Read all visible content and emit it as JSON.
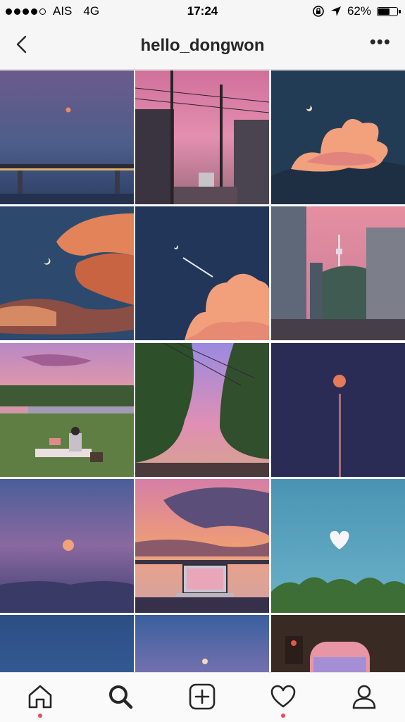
{
  "status": {
    "carrier": "AIS",
    "network": "4G",
    "time": "17:24",
    "battery": "62%",
    "battery_level": 0.62
  },
  "header": {
    "title": "hello_dongwon"
  },
  "grid": {
    "tiles": [
      {
        "alt": "moon-over-bridge-dusk"
      },
      {
        "alt": "street-with-power-lines-pink-sky"
      },
      {
        "alt": "glowing-cloud-night-sky"
      },
      {
        "alt": "crescent-moon-sunset-clouds"
      },
      {
        "alt": "airplane-trail-moon-cloud"
      },
      {
        "alt": "seoul-tower-city-street"
      },
      {
        "alt": "picnic-by-lake-sunset"
      },
      {
        "alt": "tree-lined-street-purple-sky"
      },
      {
        "alt": "full-moon-night-tower"
      },
      {
        "alt": "orange-moon-purple-sky"
      },
      {
        "alt": "laptop-sunset-waterfront"
      },
      {
        "alt": "heart-cloud-blue-sky"
      },
      {
        "alt": "blue-sky-partial"
      },
      {
        "alt": "moon-pink-horizon"
      },
      {
        "alt": "airplane-window-view"
      }
    ]
  },
  "tabbar": {
    "items": [
      {
        "name": "home",
        "icon": "home-icon",
        "has_dot": true
      },
      {
        "name": "search",
        "icon": "search-icon",
        "active": true
      },
      {
        "name": "add",
        "icon": "add-icon"
      },
      {
        "name": "activity",
        "icon": "heart-icon",
        "has_dot": true
      },
      {
        "name": "profile",
        "icon": "profile-icon"
      }
    ],
    "accent_dot_color": "#ed4956"
  }
}
